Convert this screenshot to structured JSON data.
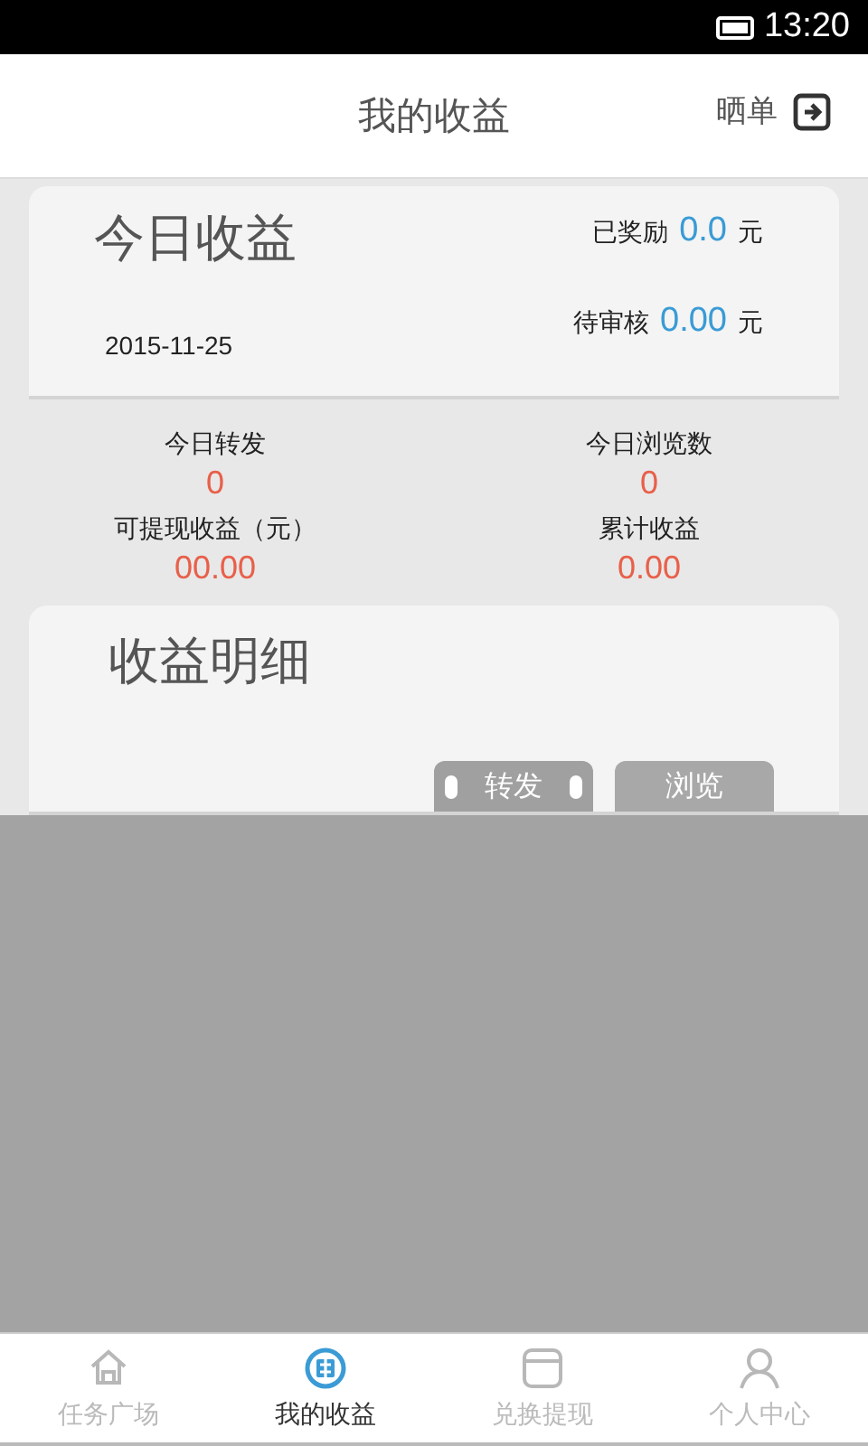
{
  "status_bar": {
    "time": "13:20"
  },
  "header": {
    "title": "我的收益",
    "action": "晒单"
  },
  "today_card": {
    "title": "今日收益",
    "date": "2015-11-25",
    "amounts": [
      {
        "label": "已奖励",
        "value": "0.0",
        "unit": "元"
      },
      {
        "label": "待审核",
        "value": "0.00",
        "unit": "元"
      }
    ]
  },
  "stats": [
    {
      "label": "今日转发",
      "value": "0"
    },
    {
      "label": "今日浏览数",
      "value": "0"
    },
    {
      "label": "可提现收益（元）",
      "value": "00.00"
    },
    {
      "label": "累计收益",
      "value": "0.00"
    }
  ],
  "detail_card": {
    "title": "收益明细",
    "tabs": [
      {
        "label": "转发",
        "selected": true
      },
      {
        "label": "浏览",
        "selected": false
      }
    ]
  },
  "bottom_nav": [
    {
      "label": "任务广场",
      "selected": false
    },
    {
      "label": "我的收益",
      "selected": true
    },
    {
      "label": "兑换提现",
      "selected": false
    },
    {
      "label": "个人中心",
      "selected": false
    }
  ]
}
